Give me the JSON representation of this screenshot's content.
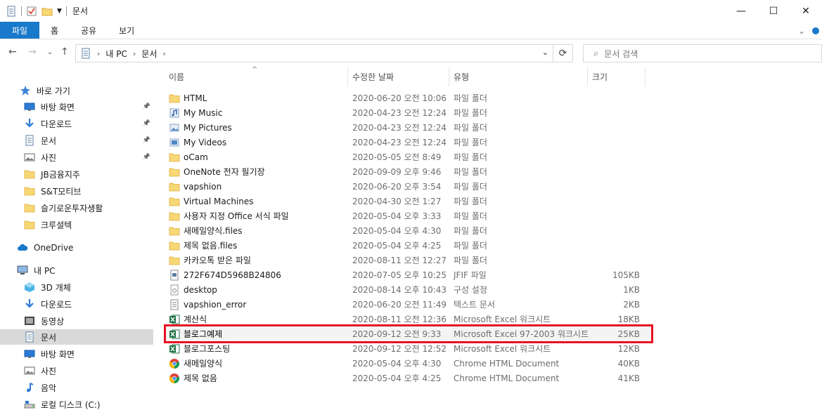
{
  "window": {
    "title": "문서",
    "controls": {
      "minimize": "—",
      "maximize": "☐",
      "close": "✕"
    }
  },
  "ribbon": {
    "tabs": [
      "파일",
      "홈",
      "공유",
      "보기"
    ],
    "expand_icon": "chevron-down-icon"
  },
  "address": {
    "path": [
      "내 PC",
      "문서"
    ],
    "search_placeholder": "문서 검색"
  },
  "sidebar": {
    "items": [
      {
        "label": "바로 가기",
        "icon": "star-icon",
        "pinned": false
      },
      {
        "label": "바탕 화면",
        "icon": "desktop-icon",
        "pinned": true
      },
      {
        "label": "다운로드",
        "icon": "download-icon",
        "pinned": true
      },
      {
        "label": "문서",
        "icon": "document-icon",
        "pinned": true
      },
      {
        "label": "사진",
        "icon": "pictures-icon",
        "pinned": true
      },
      {
        "label": "JB금융지주",
        "icon": "folder-icon",
        "pinned": false
      },
      {
        "label": "S&T모티브",
        "icon": "folder-icon",
        "pinned": false
      },
      {
        "label": "슬기로운투자생활",
        "icon": "folder-icon",
        "pinned": false
      },
      {
        "label": "크루셜텍",
        "icon": "folder-icon",
        "pinned": false
      },
      {
        "label": "OneDrive",
        "icon": "cloud-icon",
        "pinned": false
      },
      {
        "label": "내 PC",
        "icon": "pc-icon",
        "pinned": false
      },
      {
        "label": "3D 개체",
        "icon": "cube-icon",
        "pinned": false
      },
      {
        "label": "다운로드",
        "icon": "download-icon",
        "pinned": false
      },
      {
        "label": "동영상",
        "icon": "video-icon",
        "pinned": false
      },
      {
        "label": "문서",
        "icon": "document-icon",
        "pinned": false,
        "selected": true
      },
      {
        "label": "바탕 화면",
        "icon": "desktop-icon",
        "pinned": false
      },
      {
        "label": "사진",
        "icon": "pictures-icon",
        "pinned": false
      },
      {
        "label": "음악",
        "icon": "music-icon",
        "pinned": false
      },
      {
        "label": "로컬 디스크 (C:)",
        "icon": "drive-icon",
        "pinned": false
      }
    ]
  },
  "columns": {
    "name": "이름",
    "date": "수정한 날짜",
    "type": "유형",
    "size": "크기"
  },
  "files": [
    {
      "name": "HTML",
      "date": "2020-06-20 오전 10:06",
      "type": "파일 폴더",
      "size": "",
      "icon": "folder-icon"
    },
    {
      "name": "My Music",
      "date": "2020-04-23 오전 12:24",
      "type": "파일 폴더",
      "size": "",
      "icon": "music-folder-icon"
    },
    {
      "name": "My Pictures",
      "date": "2020-04-23 오전 12:24",
      "type": "파일 폴더",
      "size": "",
      "icon": "pictures-folder-icon"
    },
    {
      "name": "My Videos",
      "date": "2020-04-23 오전 12:24",
      "type": "파일 폴더",
      "size": "",
      "icon": "video-folder-icon"
    },
    {
      "name": "oCam",
      "date": "2020-05-05 오전 8:49",
      "type": "파일 폴더",
      "size": "",
      "icon": "folder-icon"
    },
    {
      "name": "OneNote 전자 필기장",
      "date": "2020-09-09 오후 9:46",
      "type": "파일 폴더",
      "size": "",
      "icon": "folder-icon"
    },
    {
      "name": "vapshion",
      "date": "2020-06-20 오후 3:54",
      "type": "파일 폴더",
      "size": "",
      "icon": "folder-icon"
    },
    {
      "name": "Virtual Machines",
      "date": "2020-04-30 오전 1:27",
      "type": "파일 폴더",
      "size": "",
      "icon": "folder-icon"
    },
    {
      "name": "사용자 지정 Office 서식 파일",
      "date": "2020-05-04 오후 3:33",
      "type": "파일 폴더",
      "size": "",
      "icon": "folder-icon"
    },
    {
      "name": "새메일양식.files",
      "date": "2020-05-04 오후 4:30",
      "type": "파일 폴더",
      "size": "",
      "icon": "folder-icon"
    },
    {
      "name": "제목 없음.files",
      "date": "2020-05-04 오후 4:25",
      "type": "파일 폴더",
      "size": "",
      "icon": "folder-icon"
    },
    {
      "name": "카카오톡 받은 파일",
      "date": "2020-08-11 오전 12:27",
      "type": "파일 폴더",
      "size": "",
      "icon": "folder-icon"
    },
    {
      "name": "272F674D5968B24806",
      "date": "2020-07-05 오후 10:25",
      "type": "JFIF 파일",
      "size": "105KB",
      "icon": "image-file-icon"
    },
    {
      "name": "desktop",
      "date": "2020-08-14 오후 10:43",
      "type": "구성 설정",
      "size": "1KB",
      "icon": "settings-file-icon"
    },
    {
      "name": "vapshion_error",
      "date": "2020-06-20 오전 11:49",
      "type": "텍스트 문서",
      "size": "2KB",
      "icon": "text-file-icon"
    },
    {
      "name": "계산식",
      "date": "2020-08-11 오전 12:36",
      "type": "Microsoft Excel 워크시트",
      "size": "18KB",
      "icon": "excel-icon"
    },
    {
      "name": "블로그예제",
      "date": "2020-09-12 오전 9:33",
      "type": "Microsoft Excel 97-2003 워크시트",
      "size": "25KB",
      "icon": "excel-icon",
      "highlighted": true
    },
    {
      "name": "블로그포스팅",
      "date": "2020-09-12 오전 12:52",
      "type": "Microsoft Excel 워크시트",
      "size": "12KB",
      "icon": "excel-icon"
    },
    {
      "name": "새메일양식",
      "date": "2020-05-04 오후 4:30",
      "type": "Chrome HTML Document",
      "size": "40KB",
      "icon": "chrome-icon"
    },
    {
      "name": "제목 없음",
      "date": "2020-05-04 오후 4:25",
      "type": "Chrome HTML Document",
      "size": "41KB",
      "icon": "chrome-icon"
    }
  ],
  "colors": {
    "file_tab": "#1979ca",
    "folder": "#f8d775",
    "excel": "#1d7044",
    "highlight_border": "#e81123",
    "selected_nav": "#d9d9d9"
  }
}
